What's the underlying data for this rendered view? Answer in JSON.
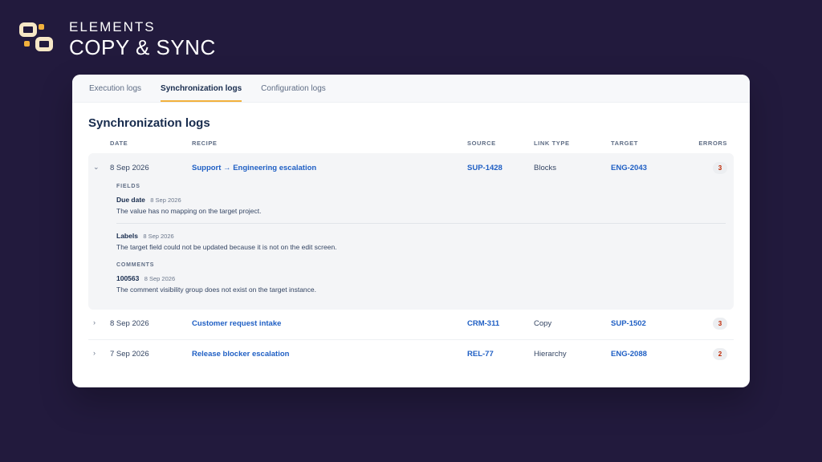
{
  "brand": {
    "top": "ELEMENTS",
    "main": "COPY & SYNC"
  },
  "tabs": [
    {
      "label": "Execution logs",
      "active": false
    },
    {
      "label": "Synchronization logs",
      "active": true
    },
    {
      "label": "Configuration logs",
      "active": false
    }
  ],
  "page_title": "Synchronization logs",
  "columns": {
    "date": "DATE",
    "recipe": "RECIPE",
    "source": "SOURCE",
    "link_type": "LINK TYPE",
    "target": "TARGET",
    "errors": "ERRORS"
  },
  "rows": [
    {
      "toggle": "⌄",
      "date": "8 Sep 2026",
      "recipe": "Support → Engineering escalation",
      "source": "SUP-1428",
      "link_type": "Blocks",
      "target": "ENG-2043",
      "errors": "3"
    },
    {
      "toggle": "›",
      "date": "8 Sep 2026",
      "recipe": "Customer request intake",
      "source": "CRM-311",
      "link_type": "Copy",
      "target": "SUP-1502",
      "errors": "3"
    },
    {
      "toggle": "›",
      "date": "7 Sep 2026",
      "recipe": "Release blocker escalation",
      "source": "REL-77",
      "link_type": "Hierarchy",
      "target": "ENG-2088",
      "errors": "2"
    }
  ],
  "details": {
    "fields_label": "FIELDS",
    "fields": [
      {
        "name": "Due date",
        "date": "8 Sep 2026",
        "message": "The value has no mapping on the target project."
      },
      {
        "name": "Labels",
        "date": "8 Sep 2026",
        "message": "The target field could not be updated because it is not on the edit screen."
      }
    ],
    "comments_label": "COMMENTS",
    "comments": [
      {
        "name": "100563",
        "date": "8 Sep 2026",
        "message": "The comment visibility group does not exist on the target instance."
      }
    ]
  },
  "colors": {
    "background": "#221a3d",
    "accent": "#f2b13c",
    "link": "#1f5fc4",
    "error_text": "#bf2600"
  }
}
